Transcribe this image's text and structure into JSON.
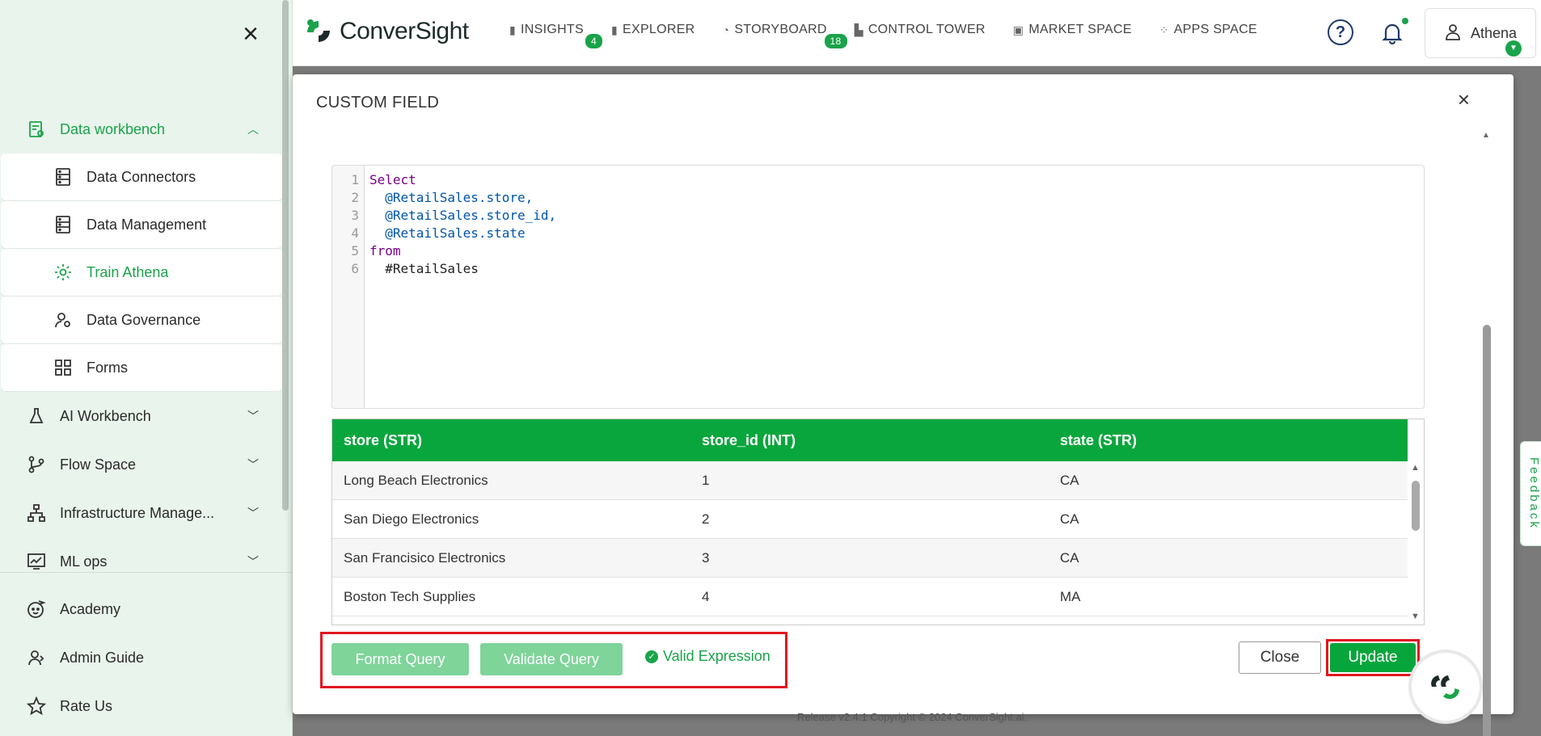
{
  "sidebar": {
    "close_icon": "close-icon",
    "items": [
      {
        "label": "Data workbench",
        "icon": "workbench-icon",
        "expanded": true
      },
      {
        "label": "AI Workbench",
        "icon": "flask-icon"
      },
      {
        "label": "Flow Space",
        "icon": "flow-icon"
      },
      {
        "label": "Infrastructure Manage...",
        "icon": "infrastructure-icon"
      },
      {
        "label": "ML ops",
        "icon": "chart-icon"
      }
    ],
    "sub_items": [
      {
        "label": "Data Connectors",
        "icon": "database-icon"
      },
      {
        "label": "Data Management",
        "icon": "database-icon"
      },
      {
        "label": "Train Athena",
        "icon": "gear-icon",
        "active": true
      },
      {
        "label": "Data Governance",
        "icon": "user-gear-icon"
      },
      {
        "label": "Forms",
        "icon": "grid-icon"
      }
    ],
    "bottom": [
      {
        "label": "Academy",
        "icon": "academy-icon"
      },
      {
        "label": "Admin Guide",
        "icon": "user-guide-icon"
      },
      {
        "label": "Rate Us",
        "icon": "star-icon"
      }
    ]
  },
  "topbar": {
    "logo_text": "ConverSight",
    "nav": [
      {
        "label": "INSIGHTS",
        "badge": "4"
      },
      {
        "label": "EXPLORER",
        "badge": ""
      },
      {
        "label": "STORYBOARD",
        "badge": "18"
      },
      {
        "label": "CONTROL TOWER",
        "badge": ""
      },
      {
        "label": "MARKET SPACE",
        "badge": ""
      },
      {
        "label": "APPS SPACE",
        "badge": ""
      }
    ],
    "help": "?",
    "user_name": "Athena"
  },
  "modal": {
    "title": "CUSTOM FIELD",
    "code_lines": [
      {
        "num": "1",
        "text": "Select"
      },
      {
        "num": "2",
        "text": "  @RetailSales.store,"
      },
      {
        "num": "3",
        "text": "  @RetailSales.store_id,"
      },
      {
        "num": "4",
        "text": "  @RetailSales.state"
      },
      {
        "num": "5",
        "text": "from"
      },
      {
        "num": "6",
        "text": "  #RetailSales"
      }
    ],
    "columns": [
      "store (STR)",
      "store_id (INT)",
      "state (STR)"
    ],
    "rows": [
      [
        "Long Beach Electronics",
        "1",
        "CA"
      ],
      [
        "San Diego Electronics",
        "2",
        "CA"
      ],
      [
        "San Francisico Electronics",
        "3",
        "CA"
      ],
      [
        "Boston Tech Supplies",
        "4",
        "MA"
      ]
    ],
    "format_button": "Format Query",
    "validate_button": "Validate Query",
    "valid_text": "Valid Expression",
    "close_button": "Close",
    "update_button": "Update"
  },
  "footer": "Release v2.4.1 Copyright © 2024 ConverSight.ai.",
  "feedback": "Feedback",
  "colors": {
    "accent": "#09a63d",
    "highlight": "#e0171f",
    "sidebar_bg": "#e9f4ec"
  }
}
